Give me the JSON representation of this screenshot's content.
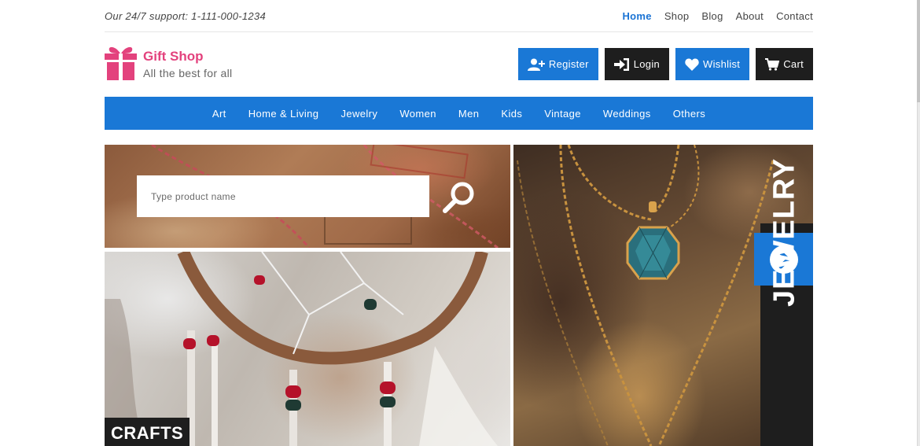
{
  "topbar": {
    "support_text": "Our 24/7 support: 1-111-000-1234",
    "links": [
      "Home",
      "Shop",
      "Blog",
      "About",
      "Contact"
    ],
    "active_link": "Home"
  },
  "brand": {
    "title": "Gift Shop",
    "subtitle": "All the best for all",
    "icon": "gift-icon"
  },
  "actions": {
    "register": "Register",
    "login": "Login",
    "wishlist": "Wishlist",
    "cart": "Cart"
  },
  "categories": [
    "Art",
    "Home & Living",
    "Jewelry",
    "Women",
    "Men",
    "Kids",
    "Vintage",
    "Weddings",
    "Others"
  ],
  "search": {
    "placeholder": "Type product name"
  },
  "tiles": {
    "crafts": "CRAFTS",
    "jewelry": "JEWELRY"
  },
  "colors": {
    "accent": "#1a78d6",
    "brand": "#e3427d",
    "dark": "#1e1e1e"
  }
}
